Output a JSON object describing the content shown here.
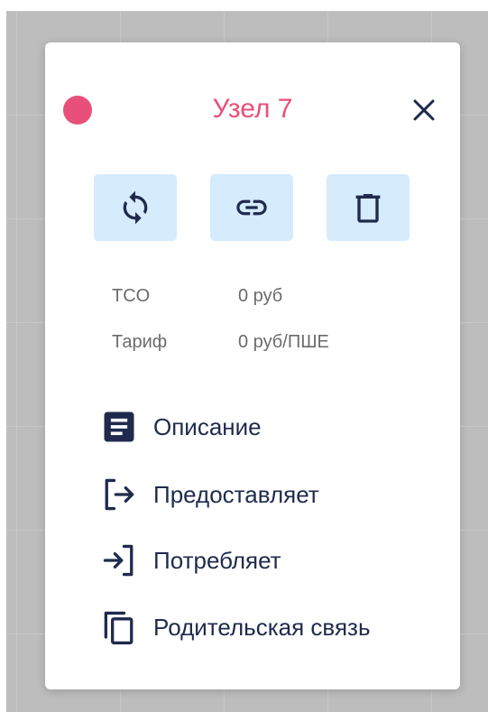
{
  "node": {
    "title": "Узел 7",
    "status_color": "#e8507a",
    "title_color": "#e8507a"
  },
  "colors": {
    "action_bg": "#d6ebfc",
    "icon_dark": "#1f2a4d",
    "close_icon": "#1f2a4d"
  },
  "icons": {
    "close": "close-icon",
    "refresh": "sync-icon",
    "link": "link-icon",
    "delete": "trash-icon"
  },
  "info": {
    "tco_label": "TCO",
    "tco_value": "0 руб",
    "tariff_label": "Тариф",
    "tariff_value": "0 руб/ПШЕ"
  },
  "menu": [
    {
      "label": "Описание",
      "icon": "description-icon"
    },
    {
      "label": "Предоставляет",
      "icon": "provides-icon"
    },
    {
      "label": "Потребляет",
      "icon": "consumes-icon"
    },
    {
      "label": "Родительская связь",
      "icon": "parent-link-icon"
    }
  ]
}
